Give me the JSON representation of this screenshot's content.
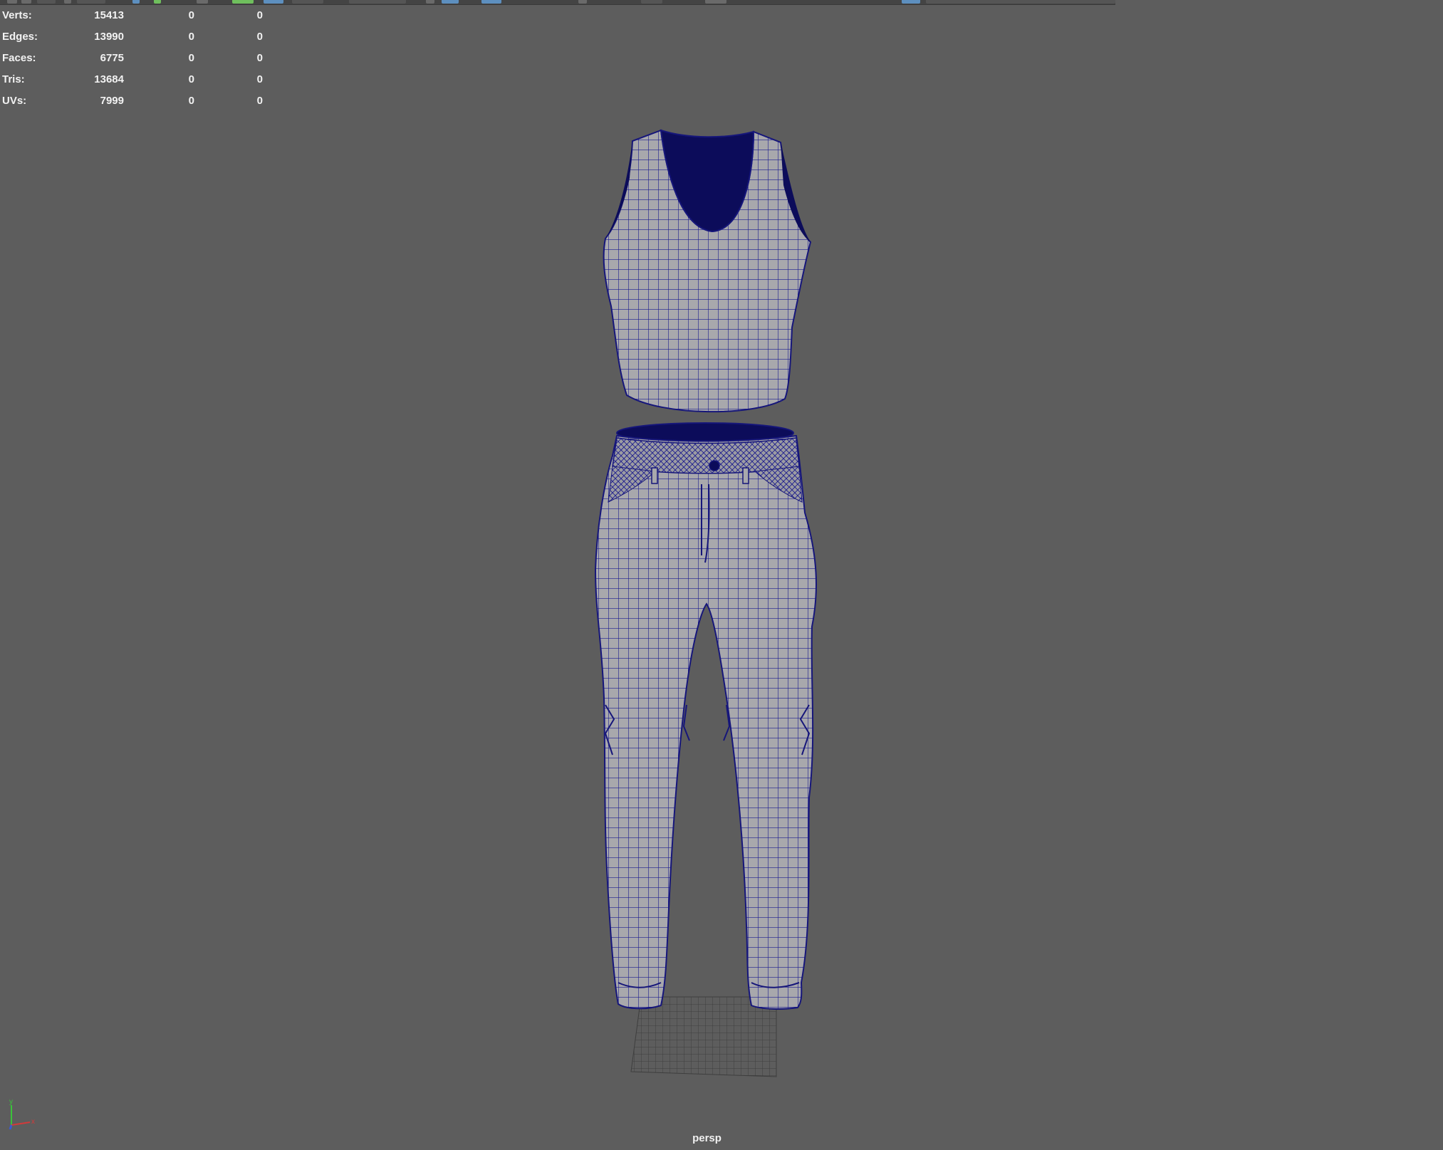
{
  "hud": {
    "rows": [
      {
        "label": "Verts:",
        "c1": "15413",
        "c2": "0",
        "c3": "0"
      },
      {
        "label": "Edges:",
        "c1": "13990",
        "c2": "0",
        "c3": "0"
      },
      {
        "label": "Faces:",
        "c1": "6775",
        "c2": "0",
        "c3": "0"
      },
      {
        "label": "Tris:",
        "c1": "13684",
        "c2": "0",
        "c3": "0"
      },
      {
        "label": "UVs:",
        "c1": "7999",
        "c2": "0",
        "c3": "0"
      }
    ]
  },
  "viewport": {
    "camera": "persp",
    "background": "#5d5d5d",
    "wireframe_color": "#1a1a8c",
    "mesh_fill": "#a8a8ac"
  },
  "axis": {
    "x_label": "x",
    "y_label": "y",
    "x_color": "#d23a3a",
    "y_color": "#3ac23a",
    "z_color": "#3a5ad2"
  },
  "toolbar": {
    "icons": [
      "select-icon",
      "lasso-icon",
      "paint-icon",
      "snap-grid-icon",
      "snap-curve-icon",
      "snap-point-icon",
      "camera-icon",
      "render-icon",
      "ipr-icon",
      "render-settings-icon",
      "hypershade-icon",
      "xray-icon",
      "wireframe-icon",
      "smooth-shade-icon",
      "textured-icon",
      "lights-icon",
      "shadows-icon",
      "isolate-icon",
      "resolution-gate-icon"
    ]
  }
}
